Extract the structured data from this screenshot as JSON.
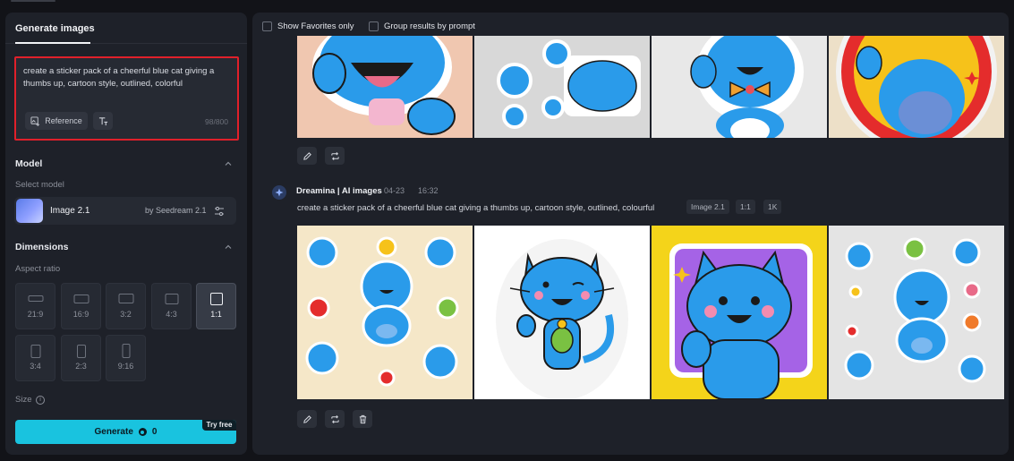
{
  "sidebar": {
    "tab": "Generate images",
    "prompt": {
      "text": "create a sticker pack of a cheerful blue cat giving a thumbs up, cartoon style, outlined, colorful",
      "reference_label": "Reference",
      "char_count": "98/800"
    },
    "model": {
      "section": "Model",
      "select_label": "Select model",
      "name": "Image 2.1",
      "by": "by Seedream 2.1"
    },
    "dimensions": {
      "section": "Dimensions",
      "aspect_label": "Aspect ratio",
      "ratios": [
        "21:9",
        "16:9",
        "3:2",
        "4:3",
        "1:1",
        "3:4",
        "2:3",
        "9:16"
      ],
      "selected": "1:1"
    },
    "size_label": "Size",
    "generate": {
      "label": "Generate",
      "credits": "0",
      "badge": "Try free"
    }
  },
  "main": {
    "filters": {
      "favorites": "Show Favorites only",
      "group": "Group results by prompt"
    },
    "generation": {
      "source": "Dreamina | AI images",
      "date": "04-23",
      "time": "16:32",
      "prompt": "create a sticker pack of a cheerful blue cat giving a thumbs up, cartoon style, outlined, colourful",
      "tags": [
        "Image 2.1",
        "1:1",
        "1K"
      ]
    }
  },
  "colors": {
    "accent": "#19c3df",
    "highlight_border": "#e0202a",
    "cat_blue": "#2a9bea"
  }
}
